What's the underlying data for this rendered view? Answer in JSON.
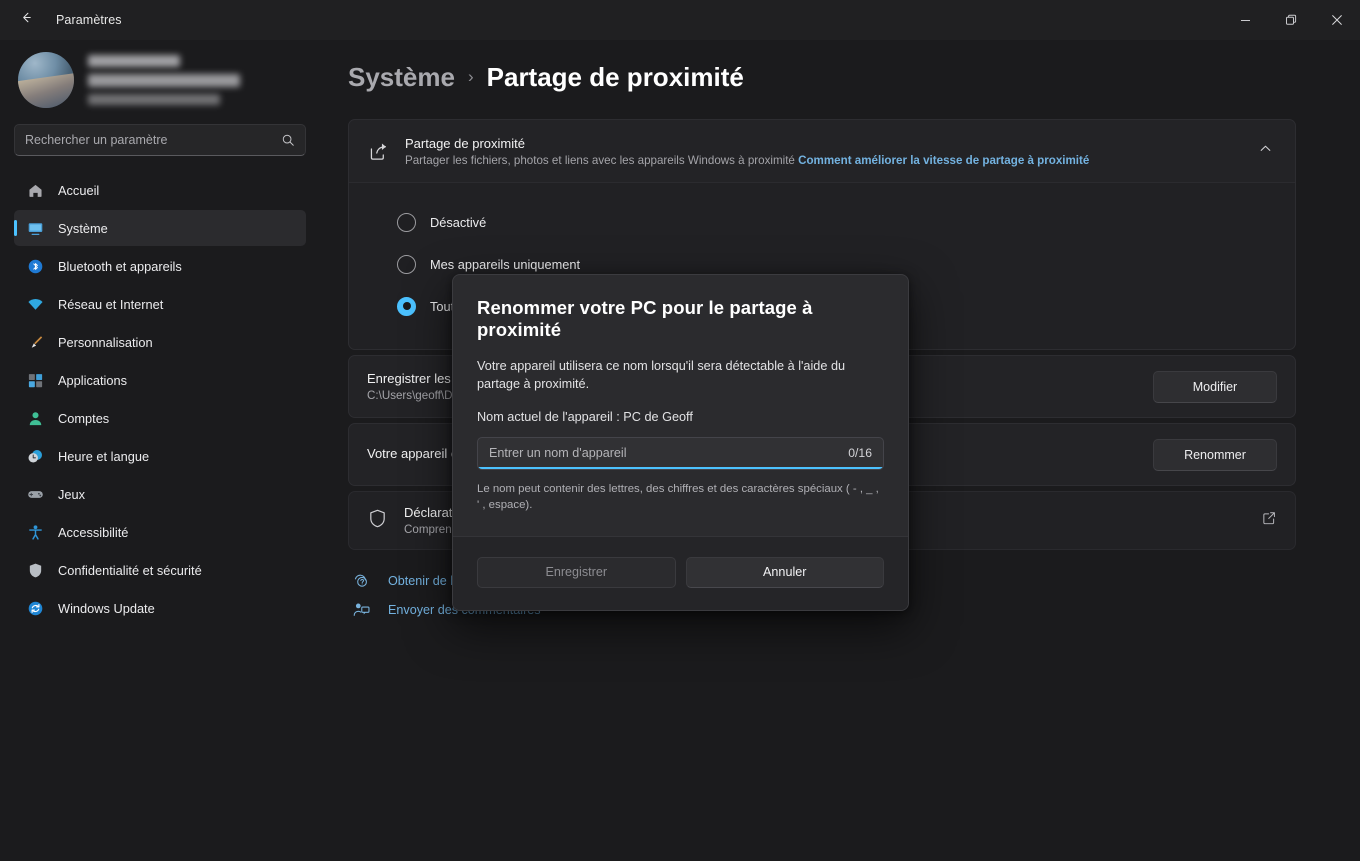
{
  "window": {
    "title": "Paramètres",
    "back_icon": "back-arrow-icon",
    "minimize_label": "Réduire",
    "maximize_label": "Agrandir",
    "close_label": "Fermer"
  },
  "sidebar": {
    "search": {
      "placeholder": "Rechercher un paramètre",
      "value": "",
      "icon": "search-icon"
    },
    "items": [
      {
        "label": "Accueil",
        "icon": "home-icon",
        "active": false
      },
      {
        "label": "Système",
        "icon": "monitor-icon",
        "active": true
      },
      {
        "label": "Bluetooth et appareils",
        "icon": "bluetooth-icon",
        "active": false
      },
      {
        "label": "Réseau et Internet",
        "icon": "wifi-icon",
        "active": false
      },
      {
        "label": "Personnalisation",
        "icon": "brush-icon",
        "active": false
      },
      {
        "label": "Applications",
        "icon": "apps-icon",
        "active": false
      },
      {
        "label": "Comptes",
        "icon": "person-icon",
        "active": false
      },
      {
        "label": "Heure et langue",
        "icon": "clock-globe-icon",
        "active": false
      },
      {
        "label": "Jeux",
        "icon": "gamepad-icon",
        "active": false
      },
      {
        "label": "Accessibilité",
        "icon": "accessibility-icon",
        "active": false
      },
      {
        "label": "Confidentialité et sécurité",
        "icon": "shield-icon",
        "active": false
      },
      {
        "label": "Windows Update",
        "icon": "update-icon",
        "active": false
      }
    ]
  },
  "main": {
    "breadcrumb": {
      "root": "Système",
      "separator": "›",
      "current": "Partage de proximité"
    },
    "nearby_card": {
      "icon": "share-icon",
      "title": "Partage de proximité",
      "subtitle": "Partager les fichiers, photos et liens avec les appareils Windows à proximité",
      "link": "Comment améliorer la vitesse de partage à proximité",
      "chevron": "chevron-up-icon",
      "options": [
        {
          "label": "Désactivé",
          "selected": false
        },
        {
          "label": "Mes appareils uniquement",
          "selected": false
        },
        {
          "label": "Tout le monde à proximité",
          "selected": true
        }
      ]
    },
    "save_location_row": {
      "title": "Enregistrer les fichiers que je reçois dans",
      "subtitle": "C:\\Users\\geoff\\Downloads",
      "button": "Modifier"
    },
    "device_name_row": {
      "title": "Votre appareil est détectable en tant que « PC de Geoff »",
      "subtitle": "",
      "button": "Renommer"
    },
    "privacy_row": {
      "icon": "shield-icon",
      "title": "Déclaration de confidentialité",
      "subtitle": "Comprendre comment vos données sont utilisées",
      "ext_icon": "external-link-icon"
    },
    "footer_links": [
      {
        "label": "Obtenir de l'aide",
        "icon": "help-icon"
      },
      {
        "label": "Envoyer des commentaires",
        "icon": "feedback-icon"
      }
    ]
  },
  "dialog": {
    "title": "Renommer votre PC pour le partage à proximité",
    "description": "Votre appareil utilisera ce nom lorsqu'il sera détectable à l'aide du partage à proximité.",
    "current_device_label": "Nom actuel de l'appareil : PC de Geoff",
    "input": {
      "placeholder": "Entrer un nom d'appareil",
      "value": "",
      "counter": "0/16"
    },
    "hint": "Le nom peut contenir des lettres, des chiffres et des caractères spéciaux ( - , _ , ' , espace).",
    "save_label": "Enregistrer",
    "cancel_label": "Annuler"
  },
  "colors": {
    "accent": "#4cc2ff",
    "link": "#73b2e0",
    "window_bg": "#1b1b1d",
    "card_bg": "#232326",
    "dialog_bg": "#2b2b2e"
  }
}
